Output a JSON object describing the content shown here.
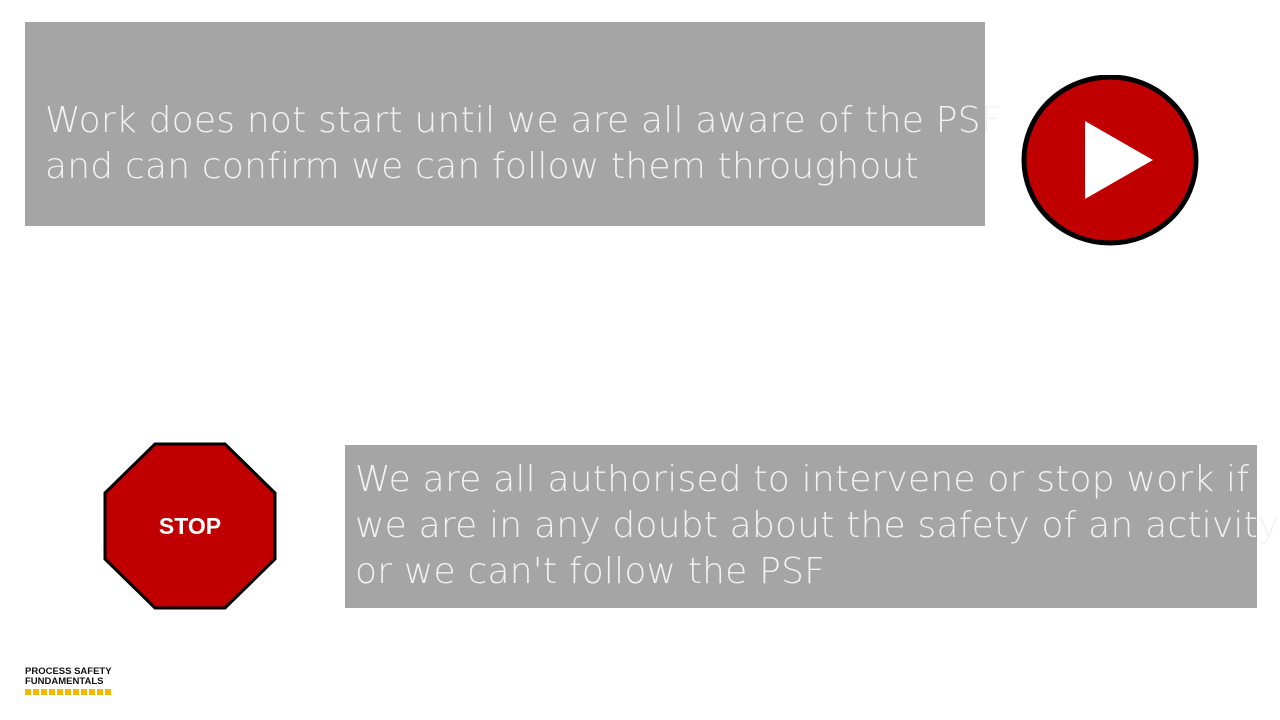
{
  "slide": {
    "top_message": {
      "lines": [
        "Work does not start until we are all aware of the PSF",
        "and can confirm we can follow them throughout"
      ]
    },
    "bottom_message": {
      "lines": [
        "We are all authorised to intervene or stop work if",
        "we are in any doubt about the safety of an activity",
        "or we can't follow the PSF"
      ]
    },
    "play_icon": {
      "icon": "play-icon",
      "fill": "#c00000",
      "outline": "#000000"
    },
    "stop_sign": {
      "icon": "stop-sign-icon",
      "label": "STOP",
      "fill": "#c00000",
      "outline": "#000000"
    },
    "logo": {
      "line1": "PROCESS SAFETY",
      "line2": "FUNDAMENTALS",
      "accent": "#f5b800"
    },
    "colors": {
      "text_box_bg": "#a5a5a5",
      "text_box_fg": "#f2f2f2"
    }
  }
}
